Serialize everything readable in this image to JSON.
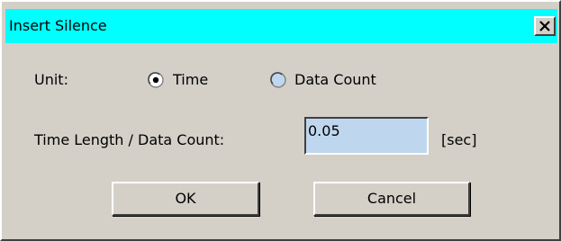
{
  "window": {
    "title": "Insert Silence",
    "close_icon": "close-icon"
  },
  "unit": {
    "label": "Unit:",
    "options": [
      {
        "label": "Time",
        "selected": true
      },
      {
        "label": "Data Count",
        "selected": false
      }
    ]
  },
  "length": {
    "label": "Time Length / Data Count:",
    "value": "0.05",
    "unit": "[sec]"
  },
  "buttons": {
    "ok_label": "OK",
    "cancel_label": "Cancel"
  },
  "colors": {
    "title_bar": "#00ffff",
    "dialog_bg": "#d4d0c8",
    "input_bg": "#bfd7ee"
  }
}
